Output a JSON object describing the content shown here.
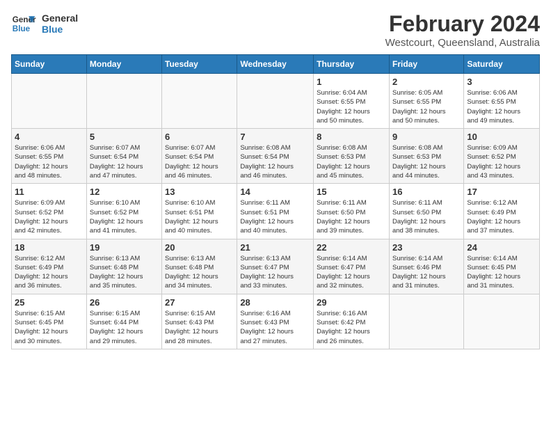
{
  "header": {
    "logo_line1": "General",
    "logo_line2": "Blue",
    "month": "February 2024",
    "location": "Westcourt, Queensland, Australia"
  },
  "days_of_week": [
    "Sunday",
    "Monday",
    "Tuesday",
    "Wednesday",
    "Thursday",
    "Friday",
    "Saturday"
  ],
  "weeks": [
    [
      {
        "date": "",
        "info": ""
      },
      {
        "date": "",
        "info": ""
      },
      {
        "date": "",
        "info": ""
      },
      {
        "date": "",
        "info": ""
      },
      {
        "date": "1",
        "info": "Sunrise: 6:04 AM\nSunset: 6:55 PM\nDaylight: 12 hours\nand 50 minutes."
      },
      {
        "date": "2",
        "info": "Sunrise: 6:05 AM\nSunset: 6:55 PM\nDaylight: 12 hours\nand 50 minutes."
      },
      {
        "date": "3",
        "info": "Sunrise: 6:06 AM\nSunset: 6:55 PM\nDaylight: 12 hours\nand 49 minutes."
      }
    ],
    [
      {
        "date": "4",
        "info": "Sunrise: 6:06 AM\nSunset: 6:55 PM\nDaylight: 12 hours\nand 48 minutes."
      },
      {
        "date": "5",
        "info": "Sunrise: 6:07 AM\nSunset: 6:54 PM\nDaylight: 12 hours\nand 47 minutes."
      },
      {
        "date": "6",
        "info": "Sunrise: 6:07 AM\nSunset: 6:54 PM\nDaylight: 12 hours\nand 46 minutes."
      },
      {
        "date": "7",
        "info": "Sunrise: 6:08 AM\nSunset: 6:54 PM\nDaylight: 12 hours\nand 46 minutes."
      },
      {
        "date": "8",
        "info": "Sunrise: 6:08 AM\nSunset: 6:53 PM\nDaylight: 12 hours\nand 45 minutes."
      },
      {
        "date": "9",
        "info": "Sunrise: 6:08 AM\nSunset: 6:53 PM\nDaylight: 12 hours\nand 44 minutes."
      },
      {
        "date": "10",
        "info": "Sunrise: 6:09 AM\nSunset: 6:52 PM\nDaylight: 12 hours\nand 43 minutes."
      }
    ],
    [
      {
        "date": "11",
        "info": "Sunrise: 6:09 AM\nSunset: 6:52 PM\nDaylight: 12 hours\nand 42 minutes."
      },
      {
        "date": "12",
        "info": "Sunrise: 6:10 AM\nSunset: 6:52 PM\nDaylight: 12 hours\nand 41 minutes."
      },
      {
        "date": "13",
        "info": "Sunrise: 6:10 AM\nSunset: 6:51 PM\nDaylight: 12 hours\nand 40 minutes."
      },
      {
        "date": "14",
        "info": "Sunrise: 6:11 AM\nSunset: 6:51 PM\nDaylight: 12 hours\nand 40 minutes."
      },
      {
        "date": "15",
        "info": "Sunrise: 6:11 AM\nSunset: 6:50 PM\nDaylight: 12 hours\nand 39 minutes."
      },
      {
        "date": "16",
        "info": "Sunrise: 6:11 AM\nSunset: 6:50 PM\nDaylight: 12 hours\nand 38 minutes."
      },
      {
        "date": "17",
        "info": "Sunrise: 6:12 AM\nSunset: 6:49 PM\nDaylight: 12 hours\nand 37 minutes."
      }
    ],
    [
      {
        "date": "18",
        "info": "Sunrise: 6:12 AM\nSunset: 6:49 PM\nDaylight: 12 hours\nand 36 minutes."
      },
      {
        "date": "19",
        "info": "Sunrise: 6:13 AM\nSunset: 6:48 PM\nDaylight: 12 hours\nand 35 minutes."
      },
      {
        "date": "20",
        "info": "Sunrise: 6:13 AM\nSunset: 6:48 PM\nDaylight: 12 hours\nand 34 minutes."
      },
      {
        "date": "21",
        "info": "Sunrise: 6:13 AM\nSunset: 6:47 PM\nDaylight: 12 hours\nand 33 minutes."
      },
      {
        "date": "22",
        "info": "Sunrise: 6:14 AM\nSunset: 6:47 PM\nDaylight: 12 hours\nand 32 minutes."
      },
      {
        "date": "23",
        "info": "Sunrise: 6:14 AM\nSunset: 6:46 PM\nDaylight: 12 hours\nand 31 minutes."
      },
      {
        "date": "24",
        "info": "Sunrise: 6:14 AM\nSunset: 6:45 PM\nDaylight: 12 hours\nand 31 minutes."
      }
    ],
    [
      {
        "date": "25",
        "info": "Sunrise: 6:15 AM\nSunset: 6:45 PM\nDaylight: 12 hours\nand 30 minutes."
      },
      {
        "date": "26",
        "info": "Sunrise: 6:15 AM\nSunset: 6:44 PM\nDaylight: 12 hours\nand 29 minutes."
      },
      {
        "date": "27",
        "info": "Sunrise: 6:15 AM\nSunset: 6:43 PM\nDaylight: 12 hours\nand 28 minutes."
      },
      {
        "date": "28",
        "info": "Sunrise: 6:16 AM\nSunset: 6:43 PM\nDaylight: 12 hours\nand 27 minutes."
      },
      {
        "date": "29",
        "info": "Sunrise: 6:16 AM\nSunset: 6:42 PM\nDaylight: 12 hours\nand 26 minutes."
      },
      {
        "date": "",
        "info": ""
      },
      {
        "date": "",
        "info": ""
      }
    ]
  ]
}
